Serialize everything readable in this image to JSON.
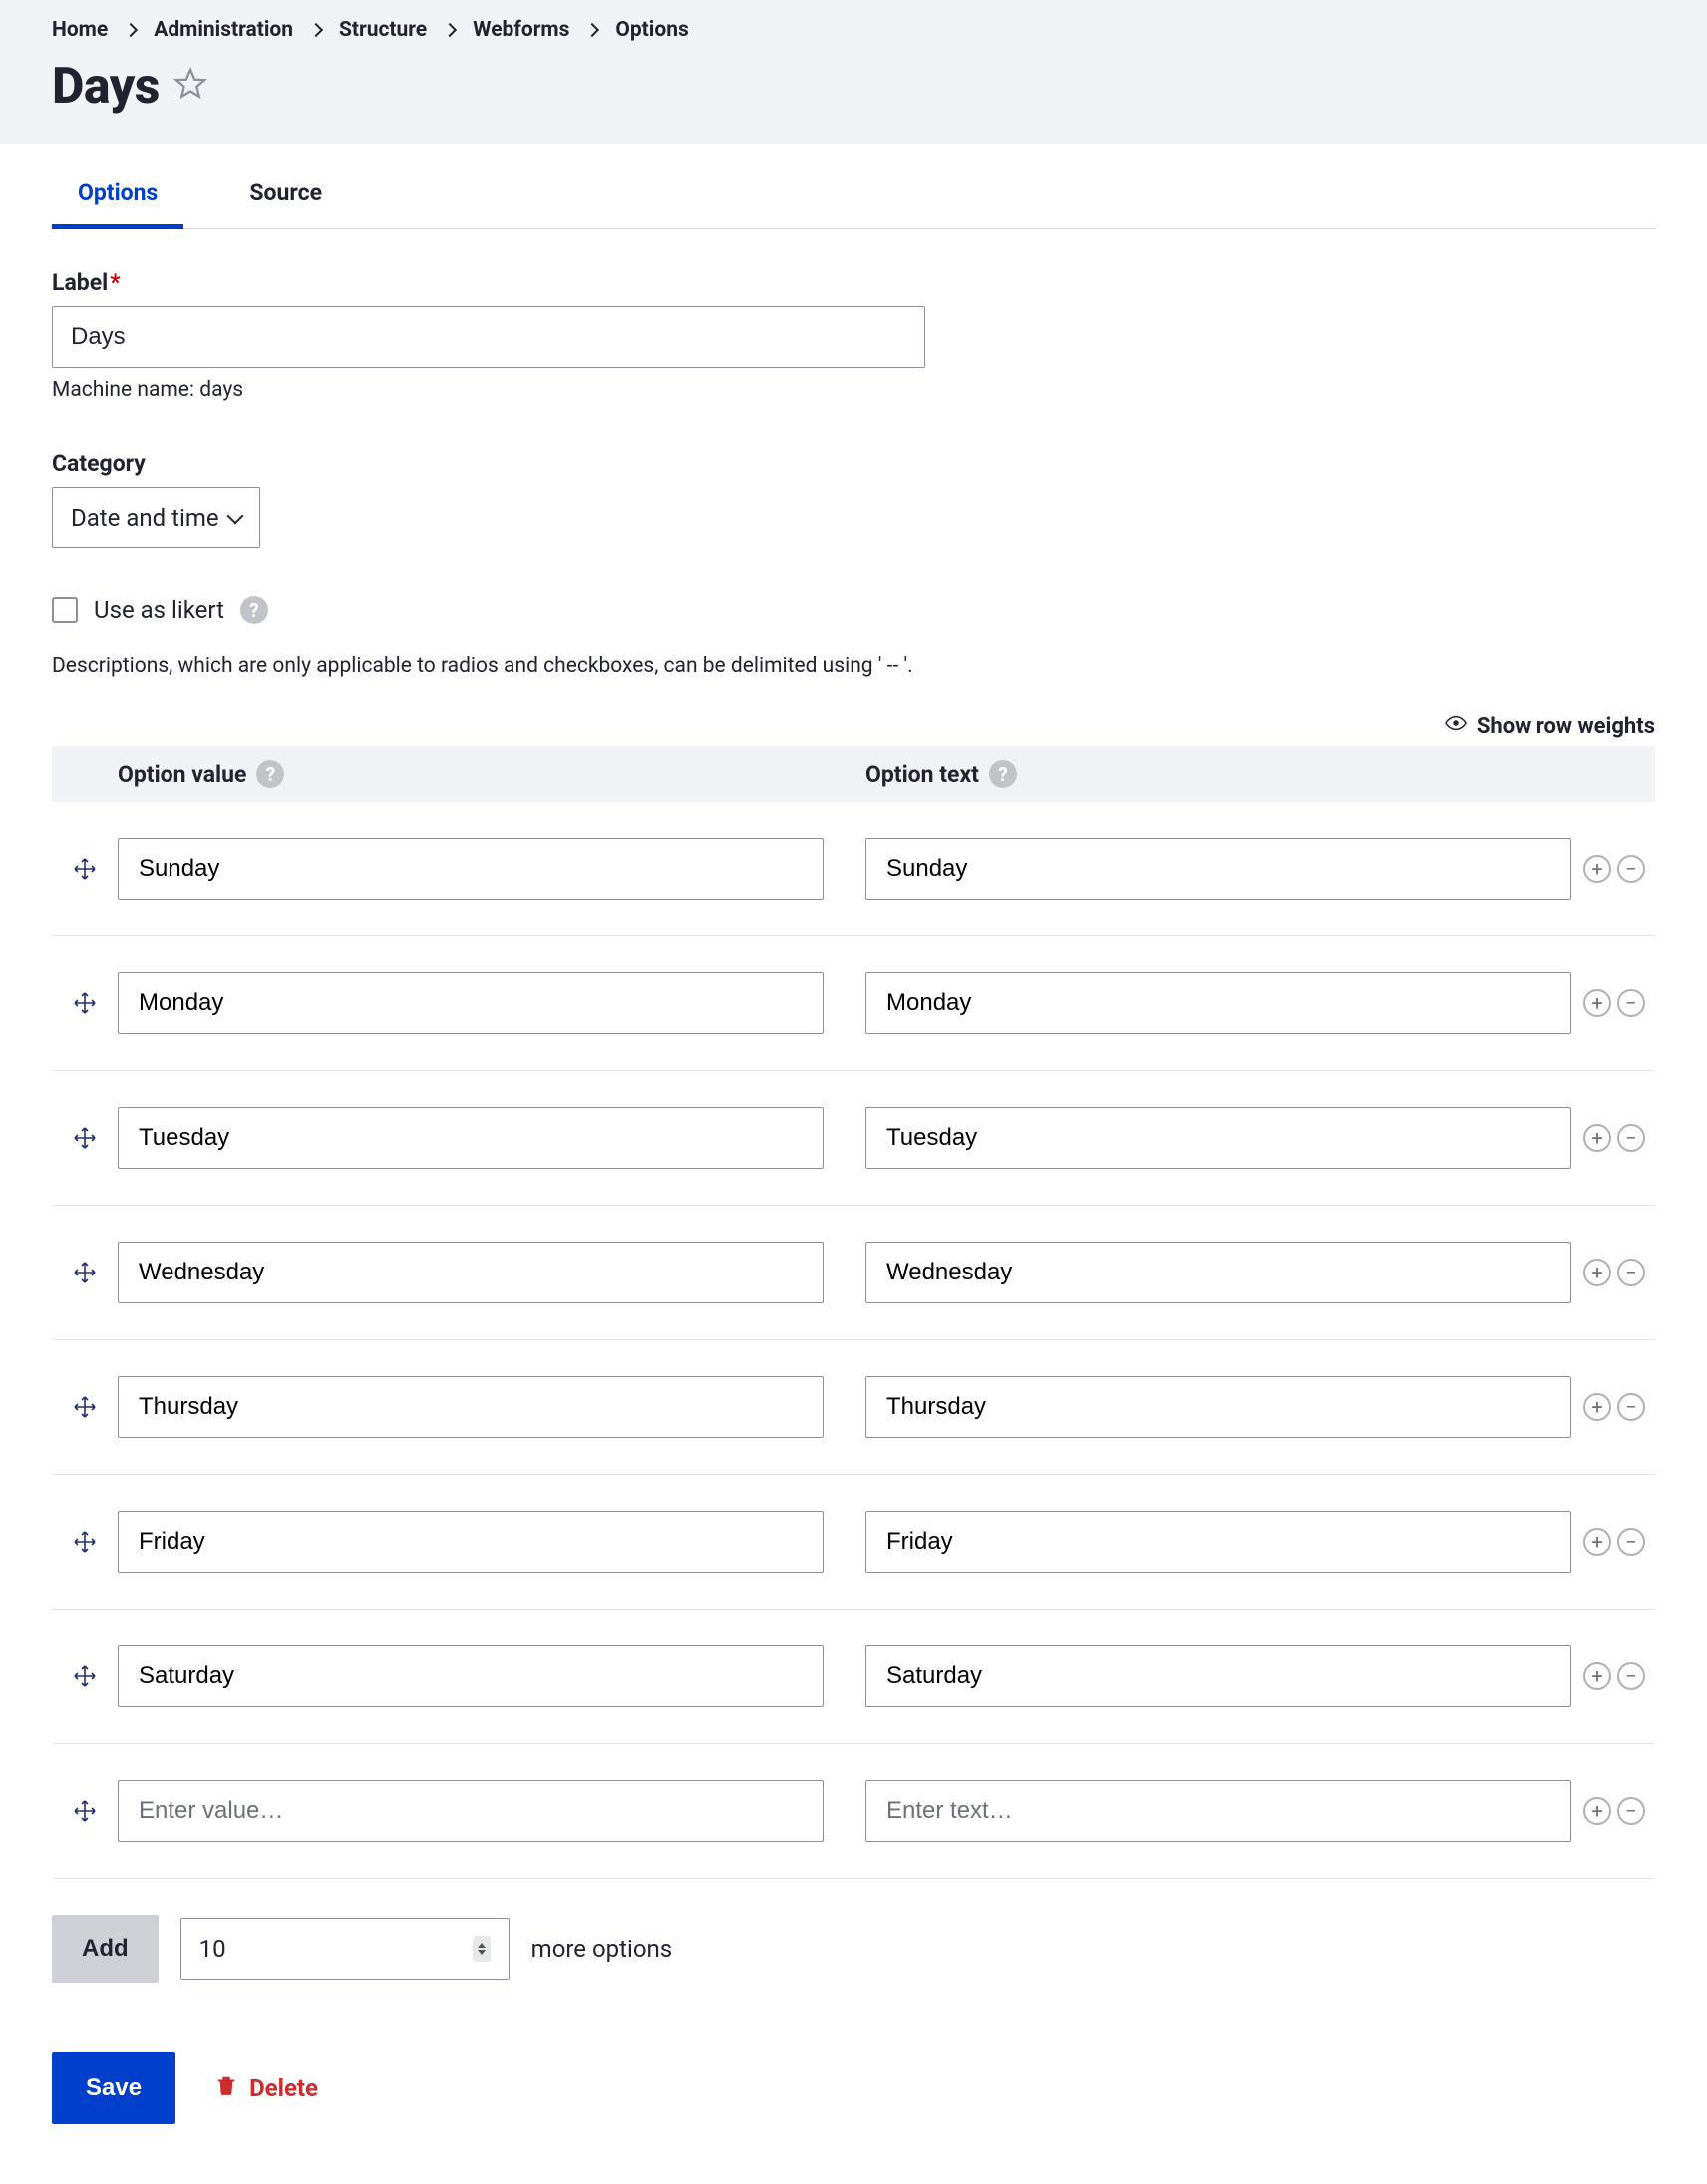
{
  "breadcrumbs": [
    "Home",
    "Administration",
    "Structure",
    "Webforms",
    "Options"
  ],
  "page_title": "Days",
  "tabs": {
    "options": "Options",
    "source": "Source"
  },
  "label": {
    "label": "Label",
    "value": "Days",
    "machine_name_prefix": "Machine name: ",
    "machine_name": "days"
  },
  "category": {
    "label": "Category",
    "value": "Date and time"
  },
  "likert": {
    "label": "Use as likert"
  },
  "description_note": "Descriptions, which are only applicable to radios and checkboxes, can be delimited using ' -- '.",
  "row_weights": "Show row weights",
  "columns": {
    "option_value": "Option value",
    "option_text": "Option text"
  },
  "rows": [
    {
      "value": "Sunday",
      "text": "Sunday"
    },
    {
      "value": "Monday",
      "text": "Monday"
    },
    {
      "value": "Tuesday",
      "text": "Tuesday"
    },
    {
      "value": "Wednesday",
      "text": "Wednesday"
    },
    {
      "value": "Thursday",
      "text": "Thursday"
    },
    {
      "value": "Friday",
      "text": "Friday"
    },
    {
      "value": "Saturday",
      "text": "Saturday"
    }
  ],
  "empty_row": {
    "value_placeholder": "Enter value…",
    "text_placeholder": "Enter text…"
  },
  "add": {
    "button": "Add",
    "count": "10",
    "suffix": "more options"
  },
  "footer": {
    "save": "Save",
    "delete": "Delete"
  }
}
